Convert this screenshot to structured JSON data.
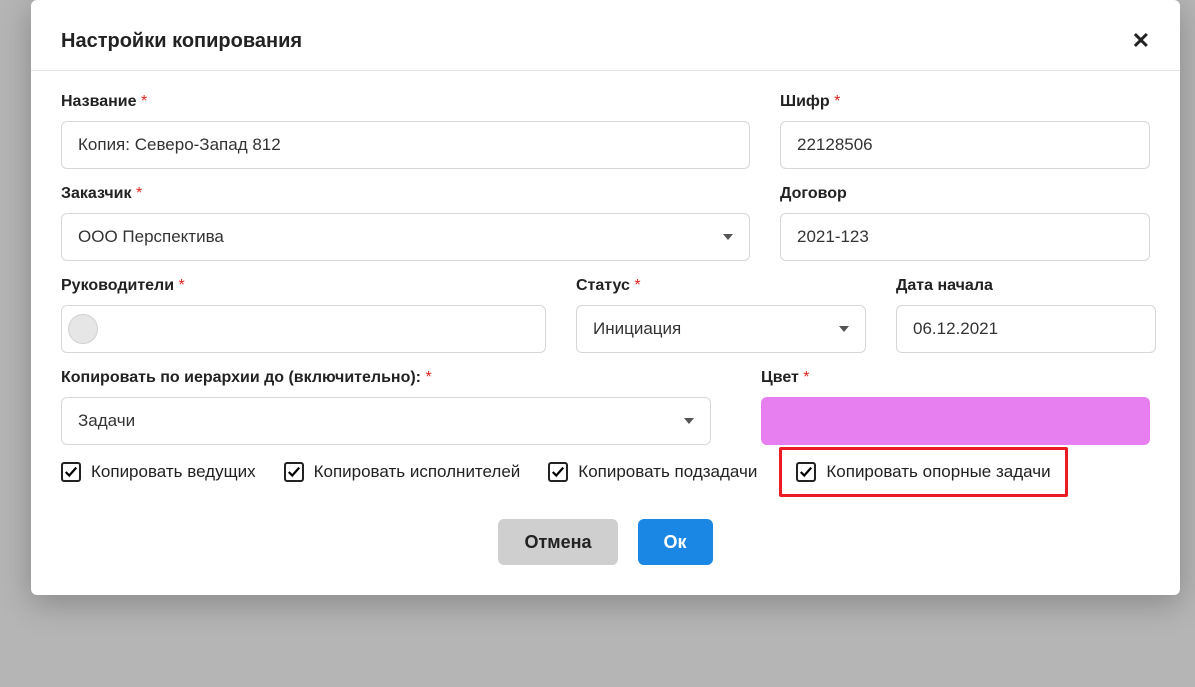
{
  "modal": {
    "title": "Настройки копирования"
  },
  "fields": {
    "name_label": "Название",
    "name_value": "Копия: Северо-Запад 812",
    "cipher_label": "Шифр",
    "cipher_value": "22128506",
    "customer_label": "Заказчик",
    "customer_value": "ООО Перспектива",
    "contract_label": "Договор",
    "contract_value": "2021-123",
    "managers_label": "Руководители",
    "status_label": "Статус",
    "status_value": "Инициация",
    "startdate_label": "Дата начала",
    "startdate_value": "06.12.2021",
    "hierarchy_label": "Копировать по иерархии до (включительно):",
    "hierarchy_value": "Задачи",
    "color_label": "Цвет",
    "color_value": "#e77ff0"
  },
  "checkboxes": {
    "copy_leads": "Копировать ведущих",
    "copy_execs": "Копировать исполнителей",
    "copy_subtasks": "Копировать подзадачи",
    "copy_reference": "Копировать опорные задачи"
  },
  "buttons": {
    "cancel": "Отмена",
    "ok": "Ок"
  }
}
